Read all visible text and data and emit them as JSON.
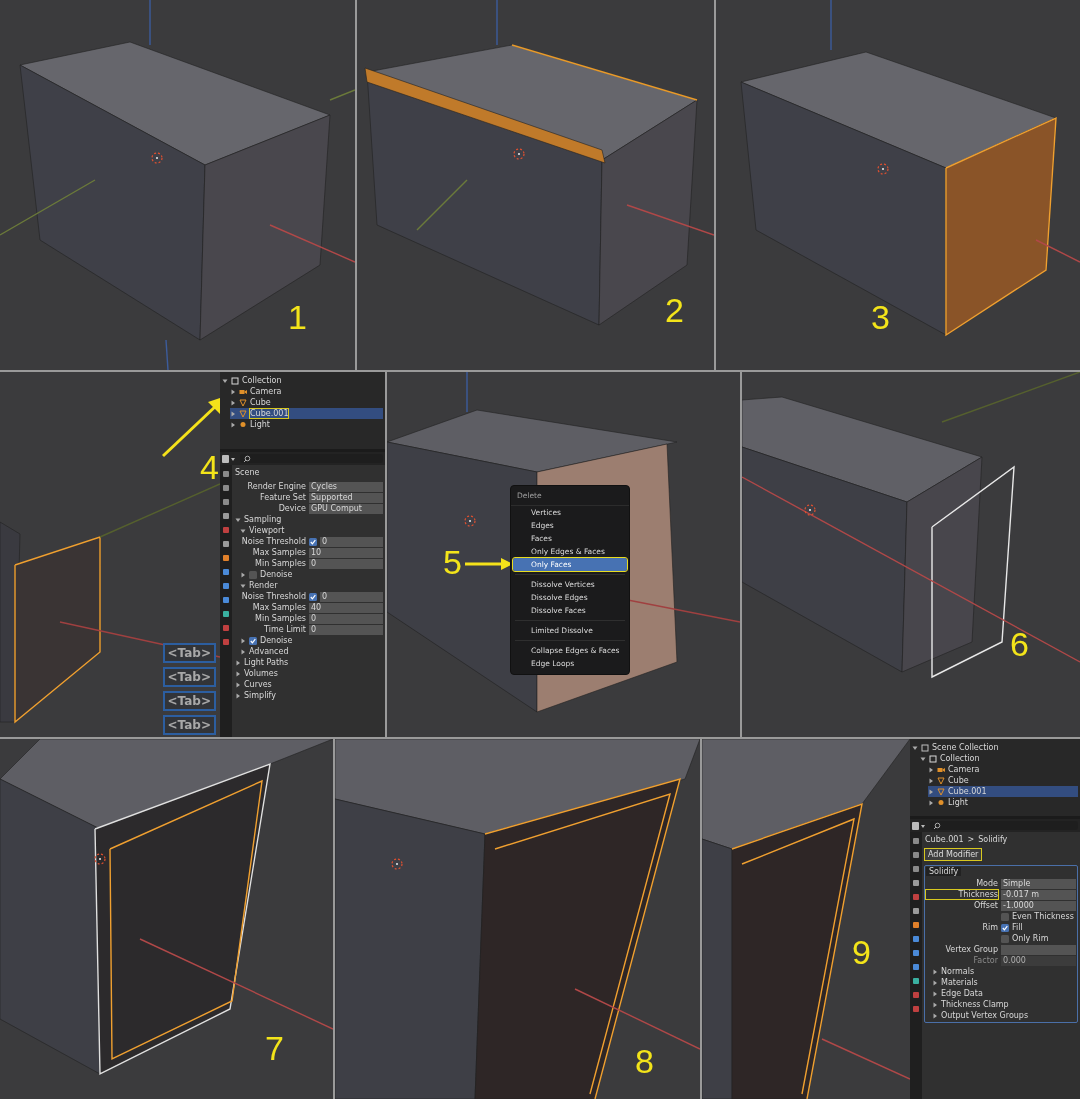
{
  "rows": [
    {
      "panels": [
        {
          "step": "1",
          "kind": "viewport"
        },
        {
          "step": "2",
          "kind": "viewport"
        },
        {
          "step": "3",
          "kind": "viewport"
        }
      ]
    },
    {
      "panels": [
        {
          "step": "4",
          "kind": "viewport",
          "tab_hints": [
            "<Tab>",
            "<Tab>",
            "<Tab>",
            "<Tab>"
          ],
          "side": {
            "outliner": [
              {
                "label": "Collection",
                "kind": "collection",
                "selected": false,
                "highlighted": false,
                "expanded": true,
                "children": [
                  {
                    "label": "Camera",
                    "kind": "camera",
                    "selected": false,
                    "highlighted": false,
                    "expanded": false
                  },
                  {
                    "label": "Cube",
                    "kind": "mesh",
                    "selected": false,
                    "highlighted": false,
                    "expanded": false
                  },
                  {
                    "label": "Cube.001",
                    "kind": "mesh",
                    "selected": true,
                    "highlighted": true,
                    "expanded": false
                  },
                  {
                    "label": "Light",
                    "kind": "light",
                    "selected": false,
                    "highlighted": false,
                    "expanded": false
                  }
                ]
              }
            ],
            "properties": {
              "header": [
                "Scene"
              ],
              "rows": [
                {
                  "kind": "field",
                  "label": "Render Engine",
                  "value": "Cycles"
                },
                {
                  "kind": "field",
                  "label": "Feature Set",
                  "value": "Supported"
                },
                {
                  "kind": "field",
                  "label": "Device",
                  "value": "GPU Comput"
                },
                {
                  "kind": "section",
                  "label": "Sampling",
                  "expanded": true
                },
                {
                  "kind": "subsection",
                  "label": "Viewport",
                  "expanded": true
                },
                {
                  "kind": "checkfield",
                  "label": "Noise Threshold",
                  "checked": true,
                  "value": "0"
                },
                {
                  "kind": "field",
                  "label": "Max Samples",
                  "value": "10"
                },
                {
                  "kind": "field",
                  "label": "Min Samples",
                  "value": "0"
                },
                {
                  "kind": "subcheck",
                  "label": "Denoise",
                  "checked": false,
                  "expanded": false
                },
                {
                  "kind": "subsection",
                  "label": "Render",
                  "expanded": true
                },
                {
                  "kind": "checkfield",
                  "label": "Noise Threshold",
                  "checked": true,
                  "value": "0"
                },
                {
                  "kind": "field",
                  "label": "Max Samples",
                  "value": "40"
                },
                {
                  "kind": "field",
                  "label": "Min Samples",
                  "value": "0"
                },
                {
                  "kind": "field",
                  "label": "Time Limit",
                  "value": "0"
                },
                {
                  "kind": "subcheck",
                  "label": "Denoise",
                  "checked": true,
                  "expanded": false
                },
                {
                  "kind": "subsection",
                  "label": "Advanced",
                  "expanded": false
                },
                {
                  "kind": "section",
                  "label": "Light Paths",
                  "expanded": false
                },
                {
                  "kind": "section",
                  "label": "Volumes",
                  "expanded": false
                },
                {
                  "kind": "section",
                  "label": "Curves",
                  "expanded": false
                },
                {
                  "kind": "section",
                  "label": "Simplify",
                  "expanded": false
                }
              ]
            }
          }
        },
        {
          "step": "5",
          "kind": "viewport",
          "menu": {
            "title": "Delete",
            "groups": [
              [
                {
                  "label": "Vertices",
                  "selected": false,
                  "highlighted": false
                },
                {
                  "label": "Edges",
                  "selected": false,
                  "highlighted": false
                },
                {
                  "label": "Faces",
                  "selected": false,
                  "highlighted": false
                },
                {
                  "label": "Only Edges & Faces",
                  "selected": false,
                  "highlighted": false
                },
                {
                  "label": "Only Faces",
                  "selected": true,
                  "highlighted": true
                }
              ],
              [
                {
                  "label": "Dissolve Vertices",
                  "selected": false,
                  "highlighted": false
                },
                {
                  "label": "Dissolve Edges",
                  "selected": false,
                  "highlighted": false
                },
                {
                  "label": "Dissolve Faces",
                  "selected": false,
                  "highlighted": false
                }
              ],
              [
                {
                  "label": "Limited Dissolve",
                  "selected": false,
                  "highlighted": false
                }
              ],
              [
                {
                  "label": "Collapse Edges & Faces",
                  "selected": false,
                  "highlighted": false
                },
                {
                  "label": "Edge Loops",
                  "selected": false,
                  "highlighted": false
                }
              ]
            ]
          }
        },
        {
          "step": "6",
          "kind": "viewport"
        }
      ]
    },
    {
      "panels": [
        {
          "step": "7",
          "kind": "viewport"
        },
        {
          "step": "8",
          "kind": "viewport"
        },
        {
          "step": "9",
          "kind": "viewport",
          "side": {
            "outliner": [
              {
                "label": "Scene Collection",
                "kind": "scene",
                "selected": false,
                "highlighted": false,
                "expanded": true,
                "children": [
                  {
                    "label": "Collection",
                    "kind": "collection",
                    "selected": false,
                    "highlighted": false,
                    "expanded": true,
                    "children": [
                      {
                        "label": "Camera",
                        "kind": "camera",
                        "selected": false,
                        "highlighted": false,
                        "expanded": false
                      },
                      {
                        "label": "Cube",
                        "kind": "mesh",
                        "selected": false,
                        "highlighted": false,
                        "expanded": false
                      },
                      {
                        "label": "Cube.001",
                        "kind": "mesh",
                        "selected": true,
                        "highlighted": false,
                        "expanded": false
                      },
                      {
                        "label": "Light",
                        "kind": "light",
                        "selected": false,
                        "highlighted": false,
                        "expanded": false
                      }
                    ]
                  }
                ]
              }
            ],
            "properties": {
              "header": [
                "Cube.001",
                ">",
                "Solidify"
              ],
              "add_button": {
                "label": "Add Modifier",
                "highlighted": true
              },
              "modifier": {
                "name": "Solidify"
              },
              "rows": [
                {
                  "kind": "field",
                  "label": "Mode",
                  "value": "Simple"
                },
                {
                  "kind": "field",
                  "label": "Thickness",
                  "value": "-0.017 m",
                  "highlighted": true
                },
                {
                  "kind": "field",
                  "label": "Offset",
                  "value": "-1.0000"
                },
                {
                  "kind": "check",
                  "text": "Even Thickness",
                  "checked": false
                },
                {
                  "kind": "check",
                  "label": "Rim",
                  "text": "Fill",
                  "checked": true
                },
                {
                  "kind": "check",
                  "text": "Only Rim",
                  "checked": false
                },
                {
                  "kind": "field",
                  "label": "Vertex Group",
                  "value": ""
                },
                {
                  "kind": "field",
                  "label": "Factor",
                  "value": "0.000",
                  "disabled": true
                },
                {
                  "kind": "subsection",
                  "label": "Normals",
                  "expanded": false
                },
                {
                  "kind": "subsection",
                  "label": "Materials",
                  "expanded": false
                },
                {
                  "kind": "subsection",
                  "label": "Edge Data",
                  "expanded": false
                },
                {
                  "kind": "subsection",
                  "label": "Thickness Clamp",
                  "expanded": false
                },
                {
                  "kind": "subsection",
                  "label": "Output Vertex Groups",
                  "expanded": false
                }
              ]
            }
          }
        }
      ]
    }
  ]
}
